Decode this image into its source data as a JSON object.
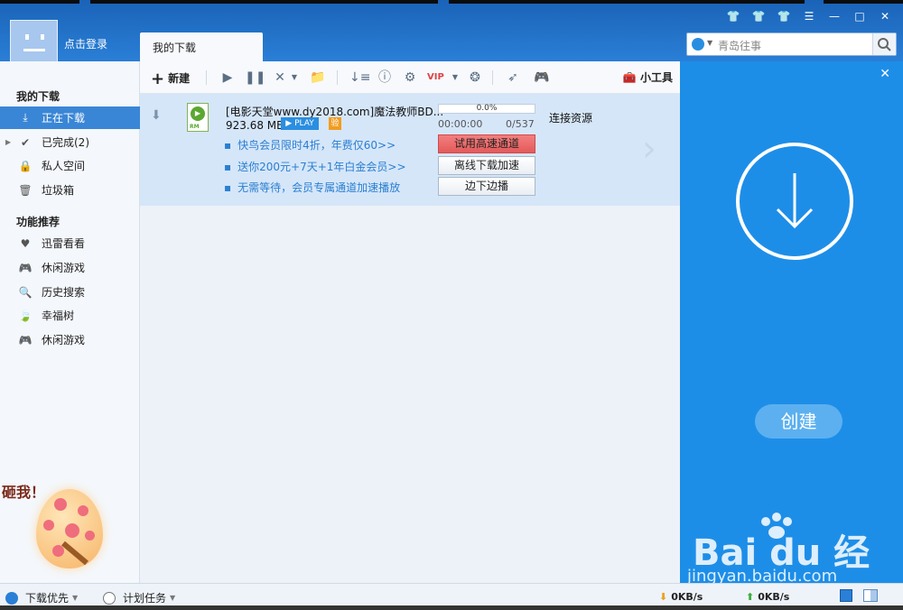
{
  "header": {
    "login_text": "点击登录",
    "tab_label": "我的下载",
    "search_placeholder": "青岛往事",
    "window_buttons": [
      "shirt-icon",
      "shirt-icon",
      "shirt-icon",
      "menu-icon",
      "minimize-icon",
      "maximize-icon",
      "close-icon"
    ]
  },
  "toolbar": {
    "new_label": "新建",
    "tools_label": "小工具"
  },
  "sidebar": {
    "section1_title": "我的下载",
    "section2_title": "功能推荐",
    "items": [
      {
        "label": "正在下载",
        "icon": "download-icon"
      },
      {
        "label": "已完成(2)",
        "icon": "check-icon"
      },
      {
        "label": "私人空间",
        "icon": "lock-icon"
      },
      {
        "label": "垃圾箱",
        "icon": "trash-icon"
      }
    ],
    "features": [
      {
        "label": "迅雷看看",
        "icon": "heart-shield-icon"
      },
      {
        "label": "休闲游戏",
        "icon": "gamepad-icon"
      },
      {
        "label": "历史搜索",
        "icon": "search-icon"
      },
      {
        "label": "幸福树",
        "icon": "leaf-icon"
      },
      {
        "label": "休闲游戏",
        "icon": "gamepad-icon"
      }
    ],
    "egg_label": "砸我！"
  },
  "task": {
    "name": "[电影天堂www.dy2018.com]魔法教师BD...",
    "size": "923.68 MB",
    "play_badge": "PLAY",
    "verify_badge": "验",
    "file_type": "RM",
    "progress_text": "0.0%",
    "progress": 0.0,
    "elapsed": "00:00:00",
    "ratio": "0/537",
    "status": "连接资源",
    "promos": [
      "快鸟会员限时4折，年费仅60>>",
      "送你200元+7天+1年白金会员>>",
      "无需等待，会员专属通道加速播放"
    ],
    "actions": [
      "试用高速通道",
      "离线下载加速",
      "边下边播"
    ]
  },
  "right_panel": {
    "create_label": "创建",
    "watermark_logo": "Bai du 经验",
    "watermark_sub": "jingyan.baidu.com"
  },
  "statusbar": {
    "priority_label": "下载优先",
    "schedule_label": "计划任务",
    "down_speed": "0KB/s",
    "up_speed": "0KB/s"
  },
  "colors": {
    "header_blue": "#2a7fd6",
    "active_item": "#3a86d6",
    "panel_blue": "#1d8ee8",
    "task_bg": "#d5e6f9",
    "promo_link": "#2a7fd0",
    "red_button": "#e45a5a"
  }
}
